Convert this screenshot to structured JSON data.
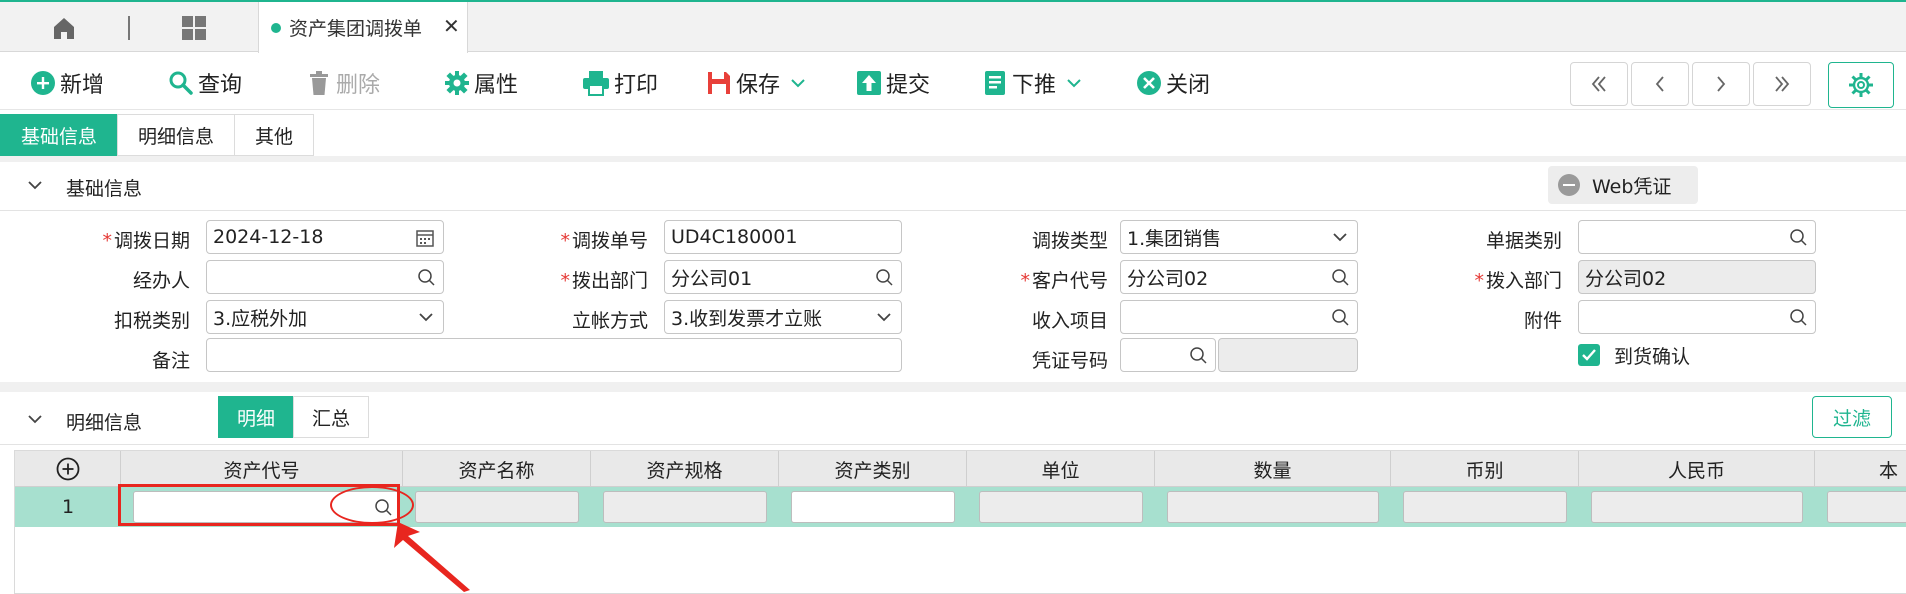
{
  "tabstrip": {
    "doc_tab_title": "资产集团调拨单",
    "close_glyph": "✕"
  },
  "toolbar": {
    "add": "新增",
    "query": "查询",
    "delete": "删除",
    "properties": "属性",
    "print": "打印",
    "save": "保存",
    "submit": "提交",
    "push_down": "下推",
    "close": "关闭"
  },
  "section_tabs": [
    "基础信息",
    "明细信息",
    "其他"
  ],
  "basic_section": {
    "title": "基础信息",
    "web_voucher": "Web凭证"
  },
  "form": {
    "transfer_date": {
      "label": "调拨日期",
      "value": "2024-12-18",
      "required": true
    },
    "transfer_no": {
      "label": "调拨单号",
      "value": "UD4C180001",
      "required": true
    },
    "transfer_type": {
      "label": "调拨类型",
      "value": "1.集团销售"
    },
    "doc_category": {
      "label": "单据类别",
      "value": ""
    },
    "handler": {
      "label": "经办人",
      "value": ""
    },
    "out_dept": {
      "label": "拨出部门",
      "value": "分公司01",
      "required": true
    },
    "customer_code": {
      "label": "客户代号",
      "value": "分公司02",
      "required": true
    },
    "in_dept": {
      "label": "拨入部门",
      "value": "分公司02",
      "required": true
    },
    "tax_type": {
      "label": "扣税类别",
      "value": "3.应税外加"
    },
    "account_method": {
      "label": "立帐方式",
      "value": "3.收到发票才立账"
    },
    "income_item": {
      "label": "收入项目",
      "value": ""
    },
    "attachment": {
      "label": "附件",
      "value": ""
    },
    "remark": {
      "label": "备注",
      "value": ""
    },
    "voucher_no": {
      "label": "凭证号码",
      "value": ""
    },
    "arrival_confirm": {
      "label": "到货确认",
      "checked": true
    }
  },
  "detail_section": {
    "title": "明细信息",
    "sub_tabs": [
      "明细",
      "汇总"
    ],
    "filter": "过滤"
  },
  "grid": {
    "columns": [
      "资产代号",
      "资产名称",
      "资产规格",
      "资产类别",
      "单位",
      "数量",
      "币别",
      "人民币",
      "本"
    ],
    "rows": [
      {
        "num": "1"
      }
    ]
  },
  "colors": {
    "accent": "#1fb58f",
    "required": "#e53935",
    "annotation": "#e8261f",
    "row_highlight": "#a7e0cf"
  }
}
